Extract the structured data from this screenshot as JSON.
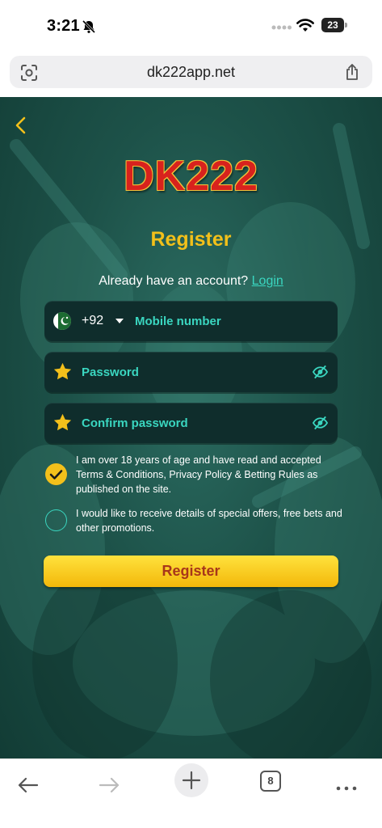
{
  "status_bar": {
    "time": "3:21",
    "battery": "23",
    "icons": [
      "bell-slash-icon",
      "signal-dots-icon",
      "wifi-icon",
      "battery-icon"
    ]
  },
  "browser": {
    "url": "dk222app.net",
    "icons": [
      "page-scan-icon",
      "share-icon"
    ]
  },
  "page": {
    "logo": "DK222",
    "title": "Register",
    "account_prompt": "Already have an account?",
    "login_label": "Login",
    "phone": {
      "country_code": "+92",
      "placeholder": "Mobile number"
    },
    "password": {
      "placeholder": "Password"
    },
    "confirm_password": {
      "placeholder": "Confirm password"
    },
    "terms": {
      "checked": true,
      "text": "I am over 18 years of age and have read and accepted Terms & Conditions, Privacy Policy & Betting Rules as published on the site."
    },
    "promotions": {
      "checked": false,
      "text": "I would like to receive details of special offers, free bets and other promotions."
    },
    "register_button": "Register"
  },
  "toolbar": {
    "tab_count": "8",
    "icons": [
      "back-arrow-icon",
      "forward-arrow-icon",
      "new-tab-plus-icon",
      "tabs-icon",
      "more-icon"
    ]
  },
  "colors": {
    "accent_yellow": "#f3c01b",
    "accent_teal": "#3ad6c0",
    "background_green": "#1d5249",
    "logo_red": "#d8221d"
  }
}
